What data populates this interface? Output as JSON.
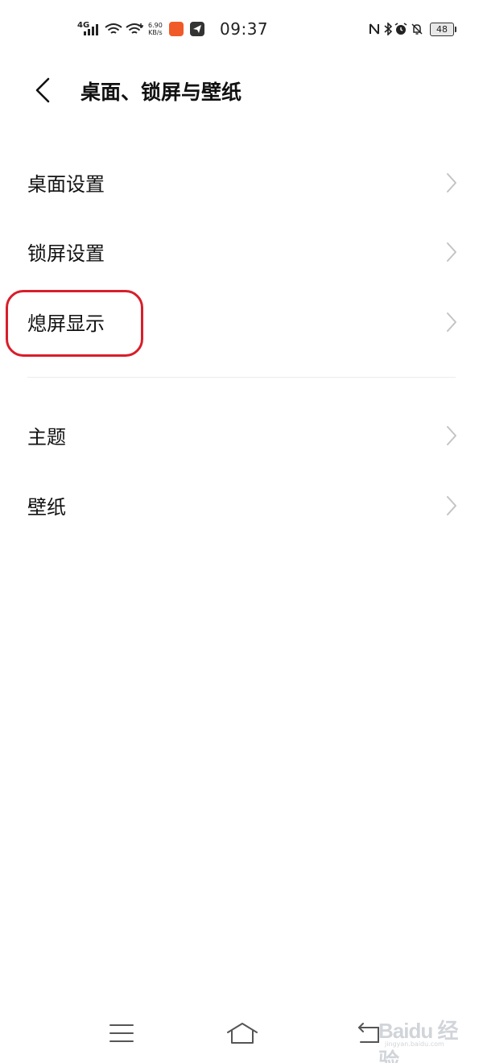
{
  "status_bar": {
    "network": "4G",
    "speed_value": "6.90",
    "speed_unit": "KB/s",
    "time": "09:37",
    "battery": "48",
    "icons": [
      "signal-icon",
      "wifi-icon",
      "wifi-plus-icon",
      "app-notification-icon",
      "telegram-icon",
      "nfc-icon",
      "bluetooth-icon",
      "alarm-icon",
      "mute-icon",
      "battery-icon"
    ]
  },
  "header": {
    "title": "桌面、锁屏与壁纸",
    "back_icon": "chevron-left-icon"
  },
  "sections": [
    {
      "items": [
        {
          "label": "桌面设置"
        },
        {
          "label": "锁屏设置"
        },
        {
          "label": "熄屏显示"
        }
      ]
    },
    {
      "items": [
        {
          "label": "主题"
        },
        {
          "label": "壁纸"
        }
      ]
    }
  ],
  "highlight": {
    "target": "熄屏显示",
    "color": "#d81e2a"
  },
  "nav_bar": {
    "icons": [
      "menu-icon",
      "home-icon",
      "back-nav-icon"
    ]
  },
  "watermark": {
    "brand": "Baidu 经验",
    "sub": "jingyan.baidu.com"
  },
  "colors": {
    "background": "#ffffff",
    "text": "#111111",
    "chevron": "#c4c4c4",
    "divider": "#ececec"
  }
}
